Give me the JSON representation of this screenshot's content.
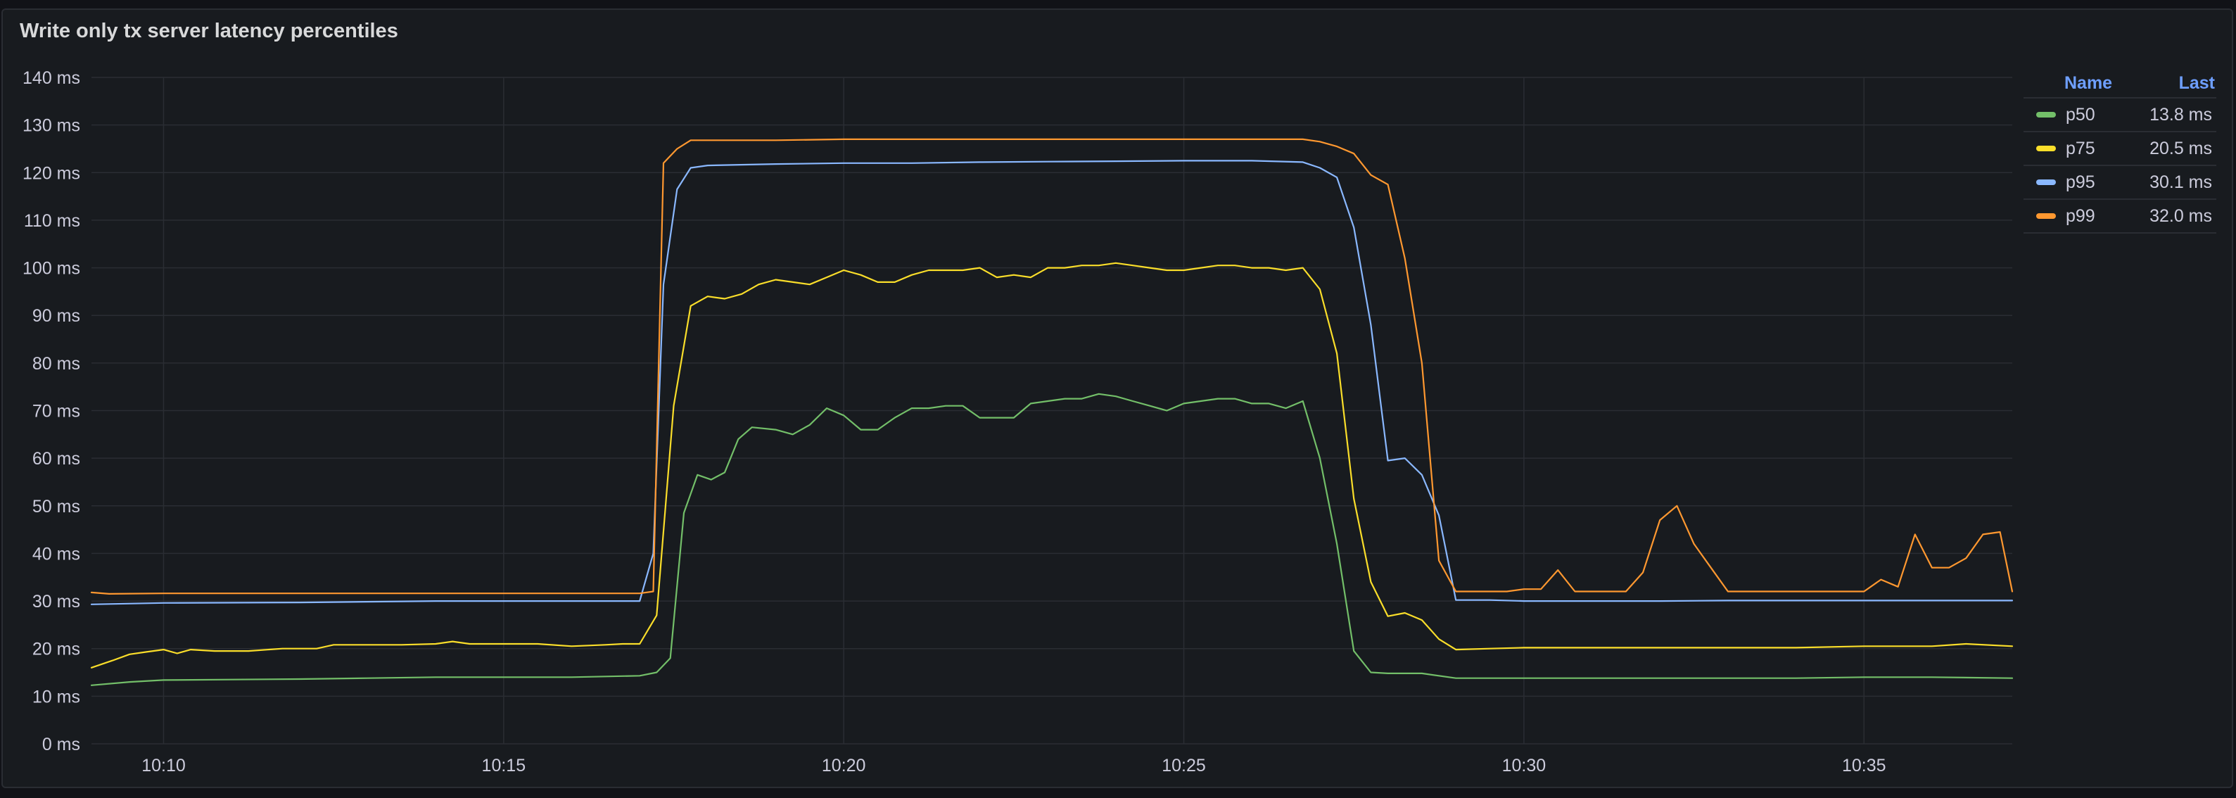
{
  "panel": {
    "title": "Write only tx server latency percentiles"
  },
  "legend": {
    "name_header": "Name",
    "last_header": "Last",
    "items": [
      {
        "name": "p50",
        "last": "13.8 ms",
        "color": "#73bf69"
      },
      {
        "name": "p75",
        "last": "20.5 ms",
        "color": "#fade2a"
      },
      {
        "name": "p95",
        "last": "30.1 ms",
        "color": "#8ab8ff"
      },
      {
        "name": "p99",
        "last": "32.0 ms",
        "color": "#ff9830"
      }
    ]
  },
  "chart_data": {
    "type": "line",
    "title": "Write only tx server latency percentiles",
    "xlabel": "",
    "ylabel": "",
    "x_unit": "minutes after 10:00",
    "xlim": [
      8.94,
      37.18
    ],
    "ylim": [
      0,
      140
    ],
    "y_ticks": [
      0,
      10,
      20,
      30,
      40,
      50,
      60,
      70,
      80,
      90,
      100,
      110,
      120,
      130,
      140
    ],
    "y_tick_labels": [
      "0 ms",
      "10 ms",
      "20 ms",
      "30 ms",
      "40 ms",
      "50 ms",
      "60 ms",
      "70 ms",
      "80 ms",
      "90 ms",
      "100 ms",
      "110 ms",
      "120 ms",
      "130 ms",
      "140 ms"
    ],
    "x_ticks": [
      10,
      15,
      20,
      25,
      30,
      35
    ],
    "x_tick_labels": [
      "10:10",
      "10:15",
      "10:20",
      "10:25",
      "10:30",
      "10:35"
    ],
    "grid": true,
    "legend_position": "right",
    "series": [
      {
        "name": "p50",
        "color": "#73bf69",
        "points": [
          [
            8.94,
            12.3
          ],
          [
            9.5,
            13.0
          ],
          [
            10.0,
            13.4
          ],
          [
            11.0,
            13.5
          ],
          [
            12.0,
            13.6
          ],
          [
            13.0,
            13.8
          ],
          [
            14.0,
            14.0
          ],
          [
            15.0,
            14.0
          ],
          [
            16.0,
            14.0
          ],
          [
            17.0,
            14.3
          ],
          [
            17.25,
            15.0
          ],
          [
            17.45,
            18.0
          ],
          [
            17.65,
            48.5
          ],
          [
            17.85,
            56.5
          ],
          [
            18.05,
            55.5
          ],
          [
            18.25,
            57.0
          ],
          [
            18.45,
            64.0
          ],
          [
            18.65,
            66.5
          ],
          [
            19.0,
            66.0
          ],
          [
            19.25,
            65.0
          ],
          [
            19.5,
            67.0
          ],
          [
            19.75,
            70.5
          ],
          [
            20.0,
            69.0
          ],
          [
            20.25,
            66.0
          ],
          [
            20.5,
            66.0
          ],
          [
            20.75,
            68.5
          ],
          [
            21.0,
            70.5
          ],
          [
            21.25,
            70.5
          ],
          [
            21.5,
            71.0
          ],
          [
            21.75,
            71.0
          ],
          [
            22.0,
            68.5
          ],
          [
            22.25,
            68.5
          ],
          [
            22.5,
            68.5
          ],
          [
            22.75,
            71.5
          ],
          [
            23.0,
            72.0
          ],
          [
            23.25,
            72.5
          ],
          [
            23.5,
            72.5
          ],
          [
            23.75,
            73.5
          ],
          [
            24.0,
            73.0
          ],
          [
            24.25,
            72.0
          ],
          [
            24.5,
            71.0
          ],
          [
            24.75,
            70.0
          ],
          [
            25.0,
            71.5
          ],
          [
            25.25,
            72.0
          ],
          [
            25.5,
            72.5
          ],
          [
            25.75,
            72.5
          ],
          [
            26.0,
            71.5
          ],
          [
            26.25,
            71.5
          ],
          [
            26.5,
            70.5
          ],
          [
            26.75,
            72.0
          ],
          [
            27.0,
            60.0
          ],
          [
            27.25,
            42.0
          ],
          [
            27.5,
            19.5
          ],
          [
            27.75,
            15.0
          ],
          [
            28.0,
            14.8
          ],
          [
            28.5,
            14.8
          ],
          [
            29.0,
            13.8
          ],
          [
            30.0,
            13.8
          ],
          [
            31.0,
            13.8
          ],
          [
            32.0,
            13.8
          ],
          [
            33.0,
            13.8
          ],
          [
            34.0,
            13.8
          ],
          [
            35.0,
            14.0
          ],
          [
            36.0,
            14.0
          ],
          [
            37.18,
            13.8
          ]
        ]
      },
      {
        "name": "p75",
        "color": "#fade2a",
        "points": [
          [
            8.94,
            16.0
          ],
          [
            9.25,
            17.5
          ],
          [
            9.5,
            18.8
          ],
          [
            9.75,
            19.3
          ],
          [
            10.0,
            19.8
          ],
          [
            10.2,
            19.0
          ],
          [
            10.4,
            19.8
          ],
          [
            10.75,
            19.5
          ],
          [
            11.25,
            19.5
          ],
          [
            11.75,
            20.0
          ],
          [
            12.25,
            20.0
          ],
          [
            12.5,
            20.8
          ],
          [
            13.0,
            20.8
          ],
          [
            13.5,
            20.8
          ],
          [
            14.0,
            21.0
          ],
          [
            14.25,
            21.5
          ],
          [
            14.5,
            21.0
          ],
          [
            15.0,
            21.0
          ],
          [
            15.5,
            21.0
          ],
          [
            16.0,
            20.5
          ],
          [
            16.5,
            20.8
          ],
          [
            16.75,
            21.0
          ],
          [
            17.0,
            21.0
          ],
          [
            17.25,
            27.0
          ],
          [
            17.5,
            71.0
          ],
          [
            17.75,
            92.0
          ],
          [
            18.0,
            94.0
          ],
          [
            18.25,
            93.5
          ],
          [
            18.5,
            94.5
          ],
          [
            18.75,
            96.5
          ],
          [
            19.0,
            97.5
          ],
          [
            19.5,
            96.5
          ],
          [
            19.75,
            98.0
          ],
          [
            20.0,
            99.5
          ],
          [
            20.25,
            98.5
          ],
          [
            20.5,
            97.0
          ],
          [
            20.75,
            97.0
          ],
          [
            21.0,
            98.5
          ],
          [
            21.25,
            99.5
          ],
          [
            21.5,
            99.5
          ],
          [
            21.75,
            99.5
          ],
          [
            22.0,
            100.0
          ],
          [
            22.25,
            98.0
          ],
          [
            22.5,
            98.5
          ],
          [
            22.75,
            98.0
          ],
          [
            23.0,
            100.0
          ],
          [
            23.25,
            100.0
          ],
          [
            23.5,
            100.5
          ],
          [
            23.75,
            100.5
          ],
          [
            24.0,
            101.0
          ],
          [
            24.25,
            100.5
          ],
          [
            24.5,
            100.0
          ],
          [
            24.75,
            99.5
          ],
          [
            25.0,
            99.5
          ],
          [
            25.25,
            100.0
          ],
          [
            25.5,
            100.5
          ],
          [
            25.75,
            100.5
          ],
          [
            26.0,
            100.0
          ],
          [
            26.25,
            100.0
          ],
          [
            26.5,
            99.5
          ],
          [
            26.75,
            100.0
          ],
          [
            27.0,
            95.5
          ],
          [
            27.25,
            82.0
          ],
          [
            27.5,
            51.5
          ],
          [
            27.75,
            34.0
          ],
          [
            28.0,
            26.8
          ],
          [
            28.25,
            27.5
          ],
          [
            28.5,
            26.0
          ],
          [
            28.75,
            22.0
          ],
          [
            29.0,
            19.8
          ],
          [
            29.5,
            20.0
          ],
          [
            30.0,
            20.2
          ],
          [
            31.0,
            20.2
          ],
          [
            32.0,
            20.2
          ],
          [
            33.0,
            20.2
          ],
          [
            34.0,
            20.2
          ],
          [
            35.0,
            20.5
          ],
          [
            36.0,
            20.5
          ],
          [
            36.5,
            21.0
          ],
          [
            37.18,
            20.5
          ]
        ]
      },
      {
        "name": "p95",
        "color": "#8ab8ff",
        "points": [
          [
            8.94,
            29.3
          ],
          [
            10.0,
            29.6
          ],
          [
            12.0,
            29.7
          ],
          [
            14.0,
            30.0
          ],
          [
            16.0,
            30.0
          ],
          [
            17.0,
            30.0
          ],
          [
            17.2,
            40.0
          ],
          [
            17.35,
            96.5
          ],
          [
            17.55,
            116.5
          ],
          [
            17.75,
            121.0
          ],
          [
            18.0,
            121.5
          ],
          [
            19.0,
            121.8
          ],
          [
            20.0,
            122.0
          ],
          [
            21.0,
            122.0
          ],
          [
            22.0,
            122.2
          ],
          [
            23.0,
            122.3
          ],
          [
            24.0,
            122.4
          ],
          [
            25.0,
            122.5
          ],
          [
            26.0,
            122.5
          ],
          [
            26.75,
            122.2
          ],
          [
            27.0,
            121.0
          ],
          [
            27.25,
            119.0
          ],
          [
            27.5,
            108.5
          ],
          [
            27.75,
            88.0
          ],
          [
            28.0,
            59.5
          ],
          [
            28.25,
            60.0
          ],
          [
            28.5,
            56.5
          ],
          [
            28.75,
            48.0
          ],
          [
            29.0,
            30.2
          ],
          [
            29.5,
            30.2
          ],
          [
            30.0,
            30.0
          ],
          [
            31.0,
            30.0
          ],
          [
            32.0,
            30.0
          ],
          [
            33.0,
            30.1
          ],
          [
            34.0,
            30.1
          ],
          [
            35.0,
            30.1
          ],
          [
            36.0,
            30.1
          ],
          [
            37.18,
            30.1
          ]
        ]
      },
      {
        "name": "p99",
        "color": "#ff9830",
        "points": [
          [
            8.94,
            31.8
          ],
          [
            9.2,
            31.5
          ],
          [
            10.0,
            31.6
          ],
          [
            11.0,
            31.6
          ],
          [
            12.0,
            31.6
          ],
          [
            13.0,
            31.6
          ],
          [
            14.0,
            31.6
          ],
          [
            15.0,
            31.6
          ],
          [
            16.0,
            31.6
          ],
          [
            17.0,
            31.6
          ],
          [
            17.2,
            32.0
          ],
          [
            17.35,
            122.0
          ],
          [
            17.55,
            125.0
          ],
          [
            17.75,
            126.8
          ],
          [
            18.0,
            126.8
          ],
          [
            19.0,
            126.8
          ],
          [
            20.0,
            127.0
          ],
          [
            21.0,
            127.0
          ],
          [
            22.0,
            127.0
          ],
          [
            23.0,
            127.0
          ],
          [
            24.0,
            127.0
          ],
          [
            25.0,
            127.0
          ],
          [
            26.0,
            127.0
          ],
          [
            26.75,
            127.0
          ],
          [
            27.0,
            126.5
          ],
          [
            27.25,
            125.5
          ],
          [
            27.5,
            124.0
          ],
          [
            27.75,
            119.5
          ],
          [
            28.0,
            117.5
          ],
          [
            28.25,
            102.0
          ],
          [
            28.5,
            80.0
          ],
          [
            28.75,
            38.5
          ],
          [
            29.0,
            32.0
          ],
          [
            29.5,
            32.0
          ],
          [
            29.75,
            32.0
          ],
          [
            30.0,
            32.5
          ],
          [
            30.25,
            32.5
          ],
          [
            30.5,
            36.5
          ],
          [
            30.75,
            32.0
          ],
          [
            31.0,
            32.0
          ],
          [
            31.5,
            32.0
          ],
          [
            31.75,
            36.0
          ],
          [
            32.0,
            47.0
          ],
          [
            32.25,
            50.0
          ],
          [
            32.5,
            42.0
          ],
          [
            32.75,
            37.0
          ],
          [
            33.0,
            32.0
          ],
          [
            33.5,
            32.0
          ],
          [
            34.0,
            32.0
          ],
          [
            34.5,
            32.0
          ],
          [
            35.0,
            32.0
          ],
          [
            35.25,
            34.5
          ],
          [
            35.5,
            33.0
          ],
          [
            35.75,
            44.0
          ],
          [
            36.0,
            37.0
          ],
          [
            36.25,
            37.0
          ],
          [
            36.5,
            39.0
          ],
          [
            36.75,
            44.0
          ],
          [
            37.0,
            44.5
          ],
          [
            37.18,
            32.0
          ]
        ]
      }
    ]
  }
}
